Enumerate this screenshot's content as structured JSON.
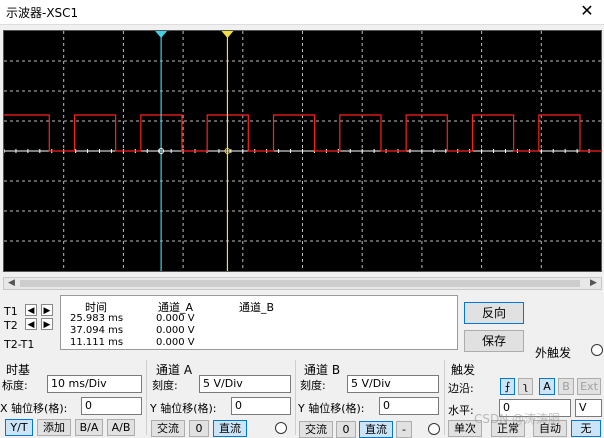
{
  "window": {
    "title": "示波器-XSC1",
    "close_glyph": "✕"
  },
  "scope": {
    "background": "#000000",
    "grid_color": "#bdbdbd",
    "trace_color": "#ff2020",
    "cursor1_color": "#40d0e0",
    "cursor2_color": "#f0e040",
    "h_divs": 10,
    "v_divs": 8,
    "square_wave": {
      "high_level_div": 1.2,
      "low_level_div": 0,
      "period_ms": 11.111,
      "duty_fraction": 0.62
    },
    "cursor_t1_ms": 25.983,
    "cursor_t2_ms": 37.094
  },
  "cursor_labels": {
    "t1": "T1",
    "t2": "T2",
    "t2t1": "T2-T1"
  },
  "readout": {
    "headers": {
      "time": "时间",
      "ch_a": "通道_A",
      "ch_b": "通道_B"
    },
    "rows": [
      {
        "time": "25.983 ms",
        "ch_a": "0.000 V"
      },
      {
        "time": "37.094 ms",
        "ch_a": "0.000 V"
      },
      {
        "time": "11.111 ms",
        "ch_a": "0.000 V"
      }
    ]
  },
  "buttons": {
    "reverse": "反向",
    "save": "保存",
    "ext_trigger": "外触发"
  },
  "timebase": {
    "title": "时基",
    "scale_label": "标度:",
    "scale_value": "10 ms/Div",
    "xpos_label": "X 轴位移(格):",
    "xpos_value": "0",
    "modes": [
      "Y/T",
      "添加",
      "B/A",
      "A/B"
    ]
  },
  "channel_a": {
    "title": "通道 A",
    "scale_label": "刻度:",
    "scale_value": "5  V/Div",
    "ypos_label": "Y 轴位移(格):",
    "ypos_value": "0",
    "coupling": [
      "交流",
      "0",
      "直流"
    ]
  },
  "channel_b": {
    "title": "通道 B",
    "scale_label": "刻度:",
    "scale_value": "5  V/Div",
    "ypos_label": "Y 轴位移(格):",
    "ypos_value": "0",
    "coupling": [
      "交流",
      "0",
      "直流",
      "-"
    ]
  },
  "trigger": {
    "title": "触发",
    "edge_label": "边沿:",
    "edge_rise": "⨍",
    "edge_fall": "ʅ",
    "sources": [
      "A",
      "B",
      "Ext"
    ],
    "level_label": "水平:",
    "level_value": "0",
    "level_unit": "V",
    "modes": [
      "单次",
      "正常",
      "自动",
      "无"
    ]
  },
  "watermark": "CSDN @涛涛胴"
}
